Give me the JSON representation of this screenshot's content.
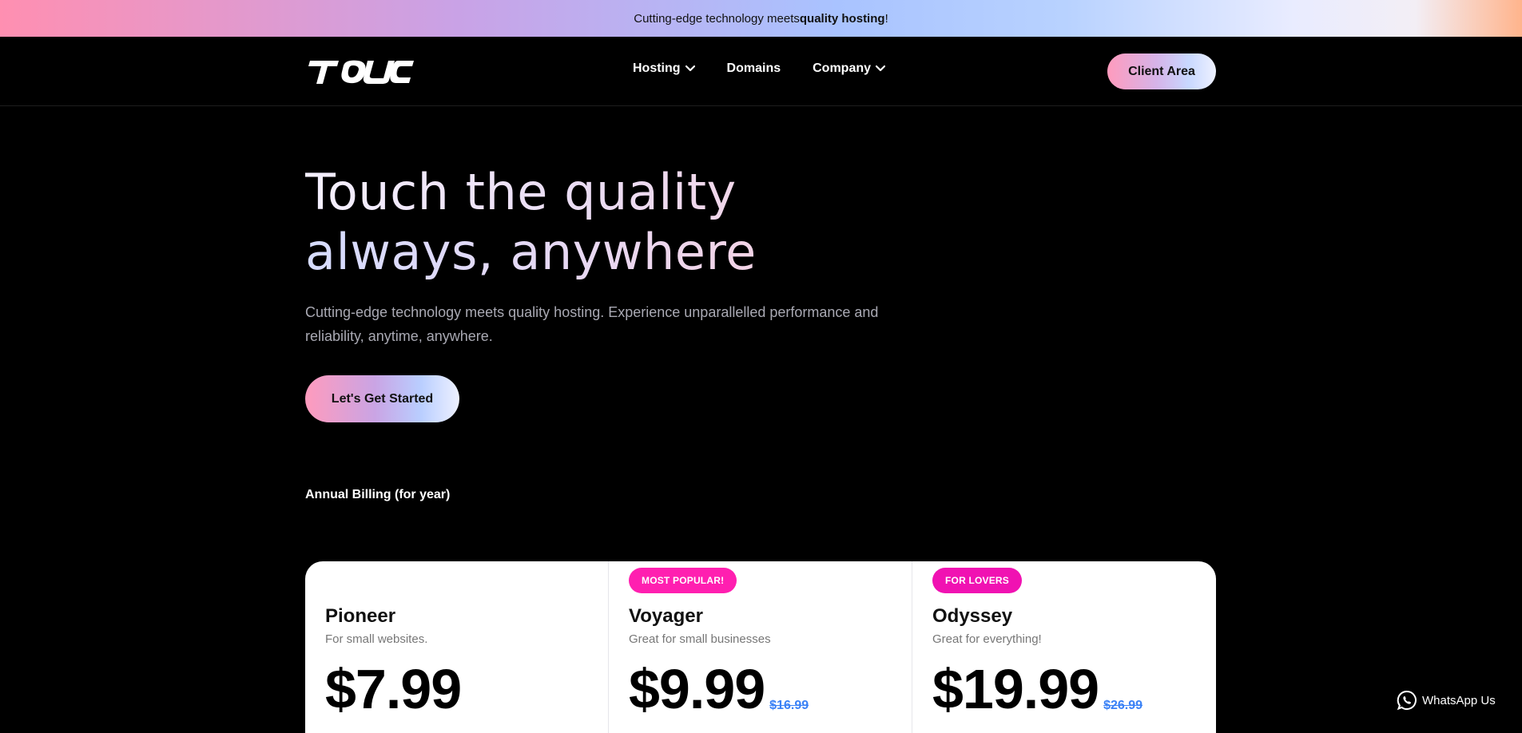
{
  "announcement": {
    "text_before": "Cutting-edge technology meets ",
    "text_bold": "quality hosting",
    "text_after": "!"
  },
  "header": {
    "logo_alt": "TOUC",
    "nav": [
      {
        "label": "Hosting",
        "has_dropdown": true
      },
      {
        "label": "Domains",
        "has_dropdown": false
      },
      {
        "label": "Company",
        "has_dropdown": true
      }
    ],
    "client_area_label": "Client Area"
  },
  "hero": {
    "title_line1": "Touch the quality",
    "title_line2": "always, anywhere",
    "subtitle": "Cutting-edge technology meets quality hosting. Experience unparallelled performance and reliability, anytime, anywhere.",
    "cta_label": "Let's Get Started"
  },
  "pricing": {
    "billing_label": "Annual Billing (for year)",
    "plans": [
      {
        "badge": "",
        "name": "Pioneer",
        "description": "For small websites.",
        "price": "$7.99",
        "old_price": ""
      },
      {
        "badge": "MOST POPULAR!",
        "name": "Voyager",
        "description": "Great for small businesses",
        "price": "$9.99",
        "old_price": "$16.99"
      },
      {
        "badge": "FOR LOVERS",
        "name": "Odyssey",
        "description": "Great for everything!",
        "price": "$19.99",
        "old_price": "$26.99"
      }
    ]
  },
  "whatsapp": {
    "label": "WhatsApp Us"
  },
  "colors": {
    "background": "#000000",
    "badge_pink": "#ff1fb0",
    "old_price_blue": "#3b82f6"
  }
}
